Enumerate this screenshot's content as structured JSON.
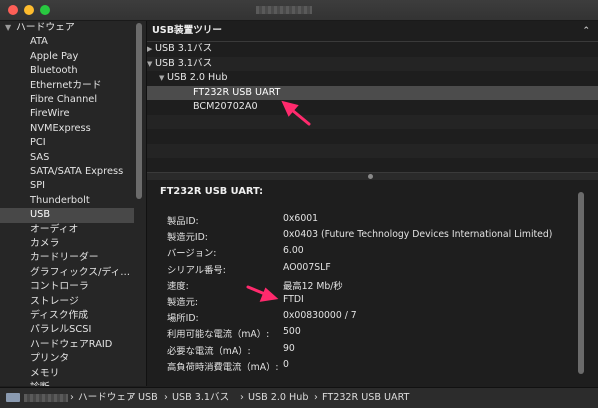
{
  "window": {
    "title_redacted": true
  },
  "sidebar": {
    "hardware_label": "ハードウェア",
    "items": [
      "ATA",
      "Apple Pay",
      "Bluetooth",
      "Ethernetカード",
      "Fibre Channel",
      "FireWire",
      "NVMExpress",
      "PCI",
      "SAS",
      "SATA/SATA Express",
      "SPI",
      "Thunderbolt",
      "USB",
      "オーディオ",
      "カメラ",
      "カードリーダー",
      "グラフィックス/ディ…",
      "コントローラ",
      "ストレージ",
      "ディスク作成",
      "パラレルSCSI",
      "ハードウェアRAID",
      "プリンタ",
      "メモリ",
      "診断"
    ],
    "selected": "USB"
  },
  "tree": {
    "header": "USB装置ツリー",
    "rows": [
      {
        "label": "USB 3.1バス",
        "expanded": false
      },
      {
        "label": "USB 3.1バス",
        "expanded": true
      },
      {
        "label": "USB 2.0 Hub",
        "expanded": true
      },
      {
        "label": "FT232R USB UART",
        "selected": true
      },
      {
        "label": "BCM20702A0"
      }
    ]
  },
  "detail": {
    "title": "FT232R USB UART:",
    "fields": [
      {
        "key": "製品ID:",
        "value": "0x6001"
      },
      {
        "key": "製造元ID:",
        "value": "0x0403  (Future Technology Devices International Limited)"
      },
      {
        "key": "バージョン:",
        "value": "6.00"
      },
      {
        "key": "シリアル番号:",
        "value": "AO007SLF"
      },
      {
        "key": "速度:",
        "value": "最高12 Mb/秒"
      },
      {
        "key": "製造元:",
        "value": "FTDI"
      },
      {
        "key": "場所ID:",
        "value": "0x00830000 / 7"
      },
      {
        "key": "利用可能な電流（mA）:",
        "value": "500"
      },
      {
        "key": "必要な電流（mA）:",
        "value": "90"
      },
      {
        "key": "高負荷時消費電流（mA）:",
        "value": "0"
      }
    ]
  },
  "statusbar": {
    "crumbs": [
      "ハードウェア",
      "USB",
      "USB 3.1バス",
      "USB 2.0 Hub",
      "FT232R USB UART"
    ],
    "separator": "›"
  },
  "annotation_color": "#ff2a6d",
  "colors": {
    "selected_row": "#4c4c4c",
    "sidebar_selected": "#484848"
  }
}
